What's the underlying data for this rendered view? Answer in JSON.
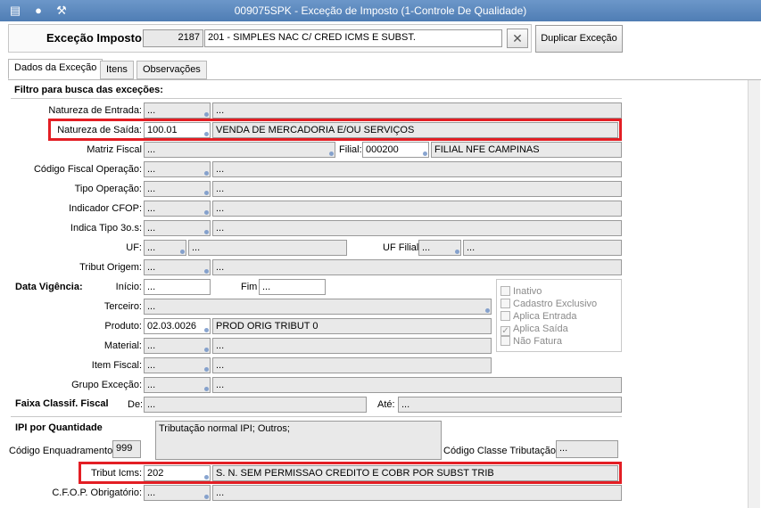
{
  "window": {
    "title": "009075SPK - Exceção de Imposto (1-Controle De Qualidade)"
  },
  "header": {
    "label": "Exceção Imposto",
    "code": "2187",
    "description": "201 - SIMPLES NAC C/ CRED ICMS E SUBST.",
    "clear_icon": "close-icon",
    "duplicate_button": "Duplicar Exceção"
  },
  "tabs": [
    "Dados da Exceção",
    "Itens",
    "Observações"
  ],
  "filter": {
    "section_title": "Filtro para busca das exceções:",
    "natureza_entrada": {
      "label": "Natureza de Entrada:",
      "code": "...",
      "desc": "..."
    },
    "natureza_saida": {
      "label": "Natureza de Saída:",
      "code": "100.01",
      "desc": "VENDA DE MERCADORIA E/OU SERVIÇOS"
    },
    "matriz_fiscal": {
      "label": "Matriz Fiscal",
      "value": "...",
      "filial_label": "Filial:",
      "filial_code": "000200",
      "filial_name": "FILIAL NFE CAMPINAS"
    },
    "codigo_fiscal": {
      "label": "Código Fiscal Operação:",
      "code": "...",
      "desc": "..."
    },
    "tipo_operacao": {
      "label": "Tipo Operação:",
      "code": "...",
      "desc": "..."
    },
    "indicador_cfop": {
      "label": "Indicador CFOP:",
      "code": "...",
      "desc": "..."
    },
    "indica_tipo": {
      "label": "Indica Tipo 3o.s:",
      "code": "...",
      "desc": "..."
    },
    "uf": {
      "label": "UF:",
      "code": "...",
      "desc": "...",
      "filial_label": "UF Filial",
      "filial_code": "...",
      "filial_desc": "..."
    },
    "tribut_origem": {
      "label": "Tribut Origem:",
      "code": "...",
      "desc": "..."
    },
    "vigencia": {
      "section": "Data Vigência:",
      "inicio_label": "Início:",
      "inicio": "...",
      "fim_label": "Fim",
      "fim": "..."
    },
    "terceiro": {
      "label": "Terceiro:",
      "value": "..."
    },
    "produto": {
      "label": "Produto:",
      "code": "02.03.0026",
      "desc": "PROD ORIG TRIBUT 0"
    },
    "material": {
      "label": "Material:",
      "code": "...",
      "desc": "..."
    },
    "item_fiscal": {
      "label": "Item Fiscal:",
      "code": "...",
      "desc": "..."
    },
    "grupo_excecao": {
      "label": "Grupo Exceção:",
      "code": "...",
      "desc": "..."
    },
    "faixa": {
      "section": "Faixa Classif. Fiscal",
      "de_label": "De:",
      "de": "...",
      "ate_label": "Até:",
      "ate": "..."
    },
    "checkboxes": [
      {
        "label": "Inativo",
        "checked": false
      },
      {
        "label": "Cadastro Exclusivo",
        "checked": false
      },
      {
        "label": "Aplica Entrada",
        "checked": false
      },
      {
        "label": "Aplica Saída",
        "checked": true
      },
      {
        "label": "Não Fatura",
        "checked": false
      }
    ]
  },
  "ipi": {
    "section": "IPI por Quantidade",
    "tributacao_text": "Tributação normal IPI; Outros;",
    "enquadramento_label": "Código Enquadramento",
    "enquadramento": "999",
    "classe_label": "Código Classe Tributação",
    "classe": "..."
  },
  "icms": {
    "label": "Tribut Icms:",
    "code": "202",
    "desc": "S. N. SEM PERMISSAO CREDITO E COBR POR SUBST TRIB"
  },
  "cfop_obrig": {
    "label": "C.F.O.P. Obrigatório:",
    "code": "...",
    "desc": "..."
  },
  "highlight_color": "#e31e24"
}
